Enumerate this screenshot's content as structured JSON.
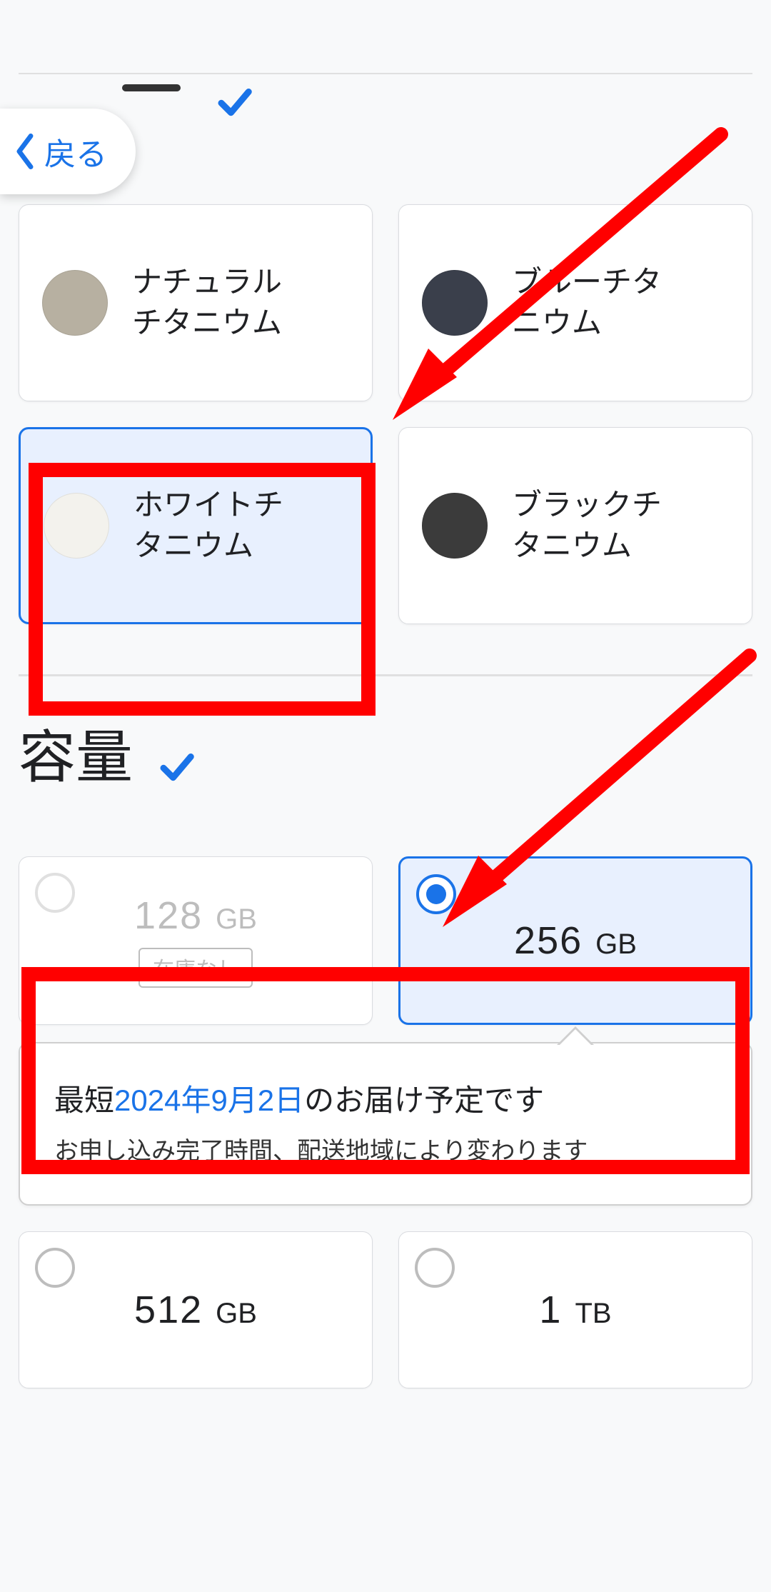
{
  "back": {
    "label": "戻る"
  },
  "sections": {
    "color": {
      "check": true,
      "options": [
        {
          "label": "ナチュラル\nチタニウム",
          "swatch": "#b7b0a1",
          "selected": false
        },
        {
          "label": "ブルーチタ\nニウム",
          "swatch": "#3a3f4b",
          "selected": false
        },
        {
          "label": "ホワイトチ\nタニウム",
          "swatch": "#f3f2ed",
          "selected": true
        },
        {
          "label": "ブラックチ\nタニウム",
          "swatch": "#3b3b3b",
          "selected": false
        }
      ]
    },
    "capacity": {
      "title": "容量",
      "check": true,
      "options": [
        {
          "value": "128",
          "unit": "GB",
          "disabled": true,
          "selected": false,
          "stock_label": "在庫なし"
        },
        {
          "value": "256",
          "unit": "GB",
          "disabled": false,
          "selected": true
        },
        {
          "value": "512",
          "unit": "GB",
          "disabled": false,
          "selected": false
        },
        {
          "value": "1",
          "unit": "TB",
          "disabled": false,
          "selected": false
        }
      ],
      "delivery": {
        "prefix": "最短",
        "date": "2024年9月2日",
        "suffix": "のお届け予定です",
        "note": "お申し込み完了時間、配送地域により変わります"
      }
    }
  },
  "annotations": {
    "highlight_color_option_index": 2,
    "highlight_capacity_row_first": true
  }
}
